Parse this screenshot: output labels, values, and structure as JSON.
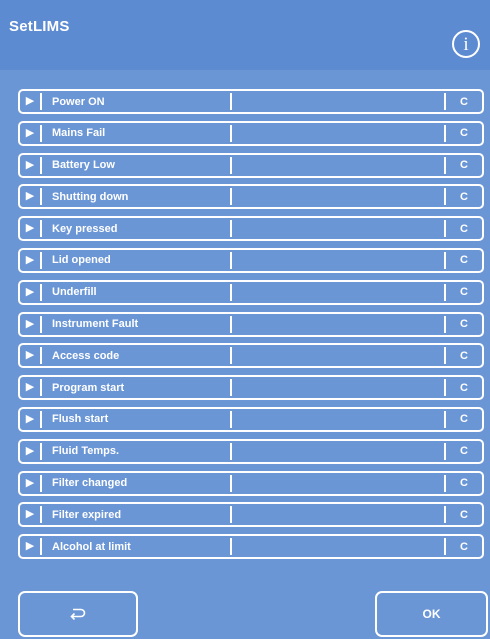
{
  "header": {
    "title": "SetLIMS",
    "info_glyph": "i",
    "info_icon": "info-icon"
  },
  "rows": [
    {
      "label": "Power ON",
      "value": "",
      "clear": "C"
    },
    {
      "label": "Mains Fail",
      "value": "",
      "clear": "C"
    },
    {
      "label": "Battery Low",
      "value": "",
      "clear": "C"
    },
    {
      "label": "Shutting down",
      "value": "",
      "clear": "C"
    },
    {
      "label": "Key pressed",
      "value": "",
      "clear": "C"
    },
    {
      "label": "Lid opened",
      "value": "",
      "clear": "C"
    },
    {
      "label": "Underfill",
      "value": "",
      "clear": "C"
    },
    {
      "label": "Instrument Fault",
      "value": "",
      "clear": "C"
    },
    {
      "label": "Access code",
      "value": "",
      "clear": "C"
    },
    {
      "label": "Program start",
      "value": "",
      "clear": "C"
    },
    {
      "label": "Flush start",
      "value": "",
      "clear": "C"
    },
    {
      "label": "Fluid Temps.",
      "value": "",
      "clear": "C"
    },
    {
      "label": "Filter changed",
      "value": "",
      "clear": "C"
    },
    {
      "label": "Filter expired",
      "value": "",
      "clear": "C"
    },
    {
      "label": "Alcohol at limit",
      "value": "",
      "clear": "C"
    }
  ],
  "footer": {
    "back_icon": "return-arrow-icon",
    "ok_label": "OK"
  },
  "colors": {
    "background": "#6b96d6",
    "header": "#5d8bd2",
    "foreground": "#ffffff"
  }
}
